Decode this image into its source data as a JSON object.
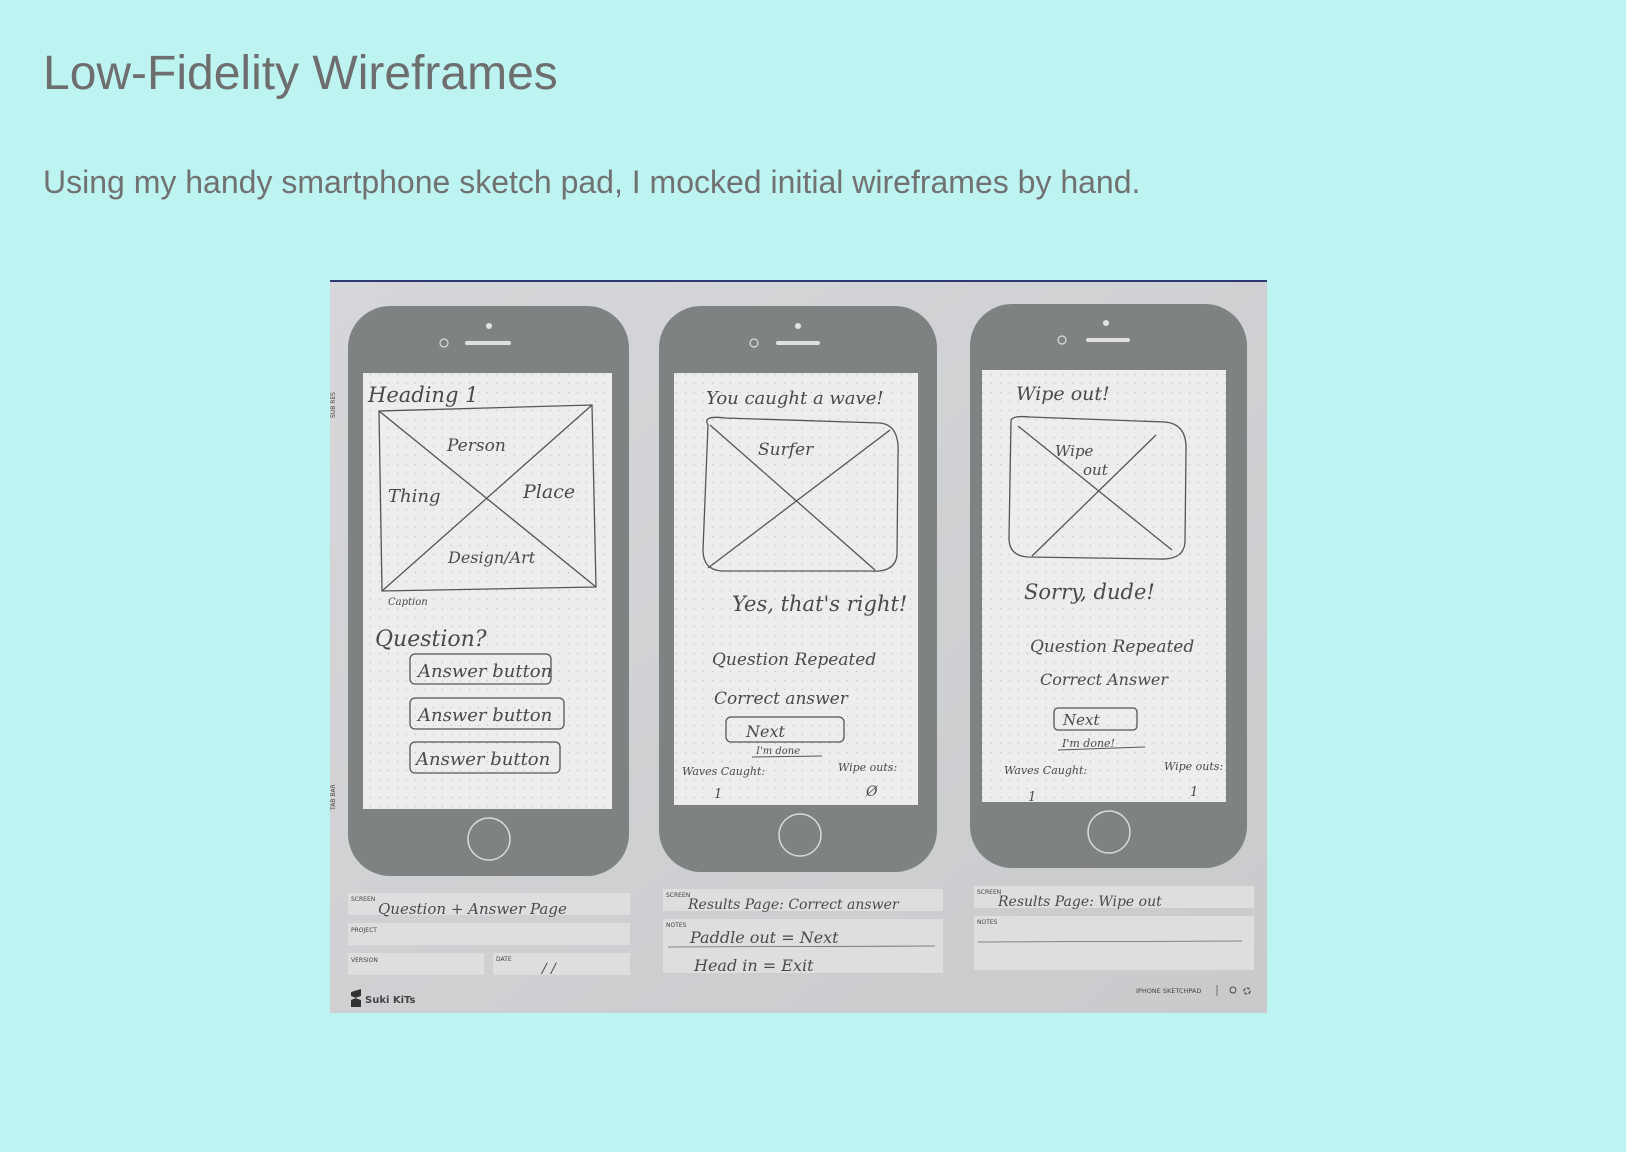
{
  "page": {
    "title": "Low-Fidelity Wireframes",
    "intro": "Using my handy smartphone sketch pad, I mocked initial wireframes by hand."
  },
  "sketch": {
    "screen1": {
      "heading": "Heading 1",
      "box_labels": [
        "Person",
        "Thing",
        "Place",
        "Design/Art"
      ],
      "caption": "Caption",
      "question": "Question?",
      "answers": [
        "Answer button",
        "Answer button",
        "Answer button"
      ]
    },
    "screen2": {
      "heading": "You caught a wave!",
      "box_label": "Surfer",
      "feedback": "Yes, that's right!",
      "question_line": "Question Repeated",
      "answer_line": "Correct answer",
      "next_label": "Next",
      "done_label": "I'm done",
      "waves_label": "Waves Caught:",
      "wipeouts_label": "Wipe outs:",
      "waves_value": "1",
      "wipeouts_value": "Ø"
    },
    "screen3": {
      "heading": "Wipe out!",
      "box_label_line1": "Wipe",
      "box_label_line2": "out",
      "feedback": "Sorry, dude!",
      "question_line": "Question Repeated",
      "answer_line": "Correct Answer",
      "next_label": "Next",
      "done_label": "I'm done!",
      "waves_label": "Waves Caught:",
      "wipeouts_label": "Wipe outs:",
      "waves_value": "1",
      "wipeouts_value": "1"
    },
    "form1": {
      "screen_label": "SCREEN",
      "screen_value": "Question + Answer Page",
      "project_label": "PROJECT",
      "version_label": "VERSION",
      "date_label": "DATE",
      "date_value": "/      /"
    },
    "form2": {
      "screen_label": "SCREEN",
      "screen_value": "Results Page: Correct answer",
      "notes_label": "NOTES",
      "note1": "Paddle out  =  Next",
      "note2": "Head in   =  Exit"
    },
    "form3": {
      "screen_label": "SCREEN",
      "screen_value": "Results Page: Wipe out",
      "notes_label": "NOTES"
    },
    "side_marks": [
      "SUB RES",
      "TAB BAR"
    ],
    "brand": "Suki KiTs",
    "product": "IPHONE SKETCHPAD",
    "footer_icons": [
      "info-icon",
      "recycle-icon"
    ]
  }
}
